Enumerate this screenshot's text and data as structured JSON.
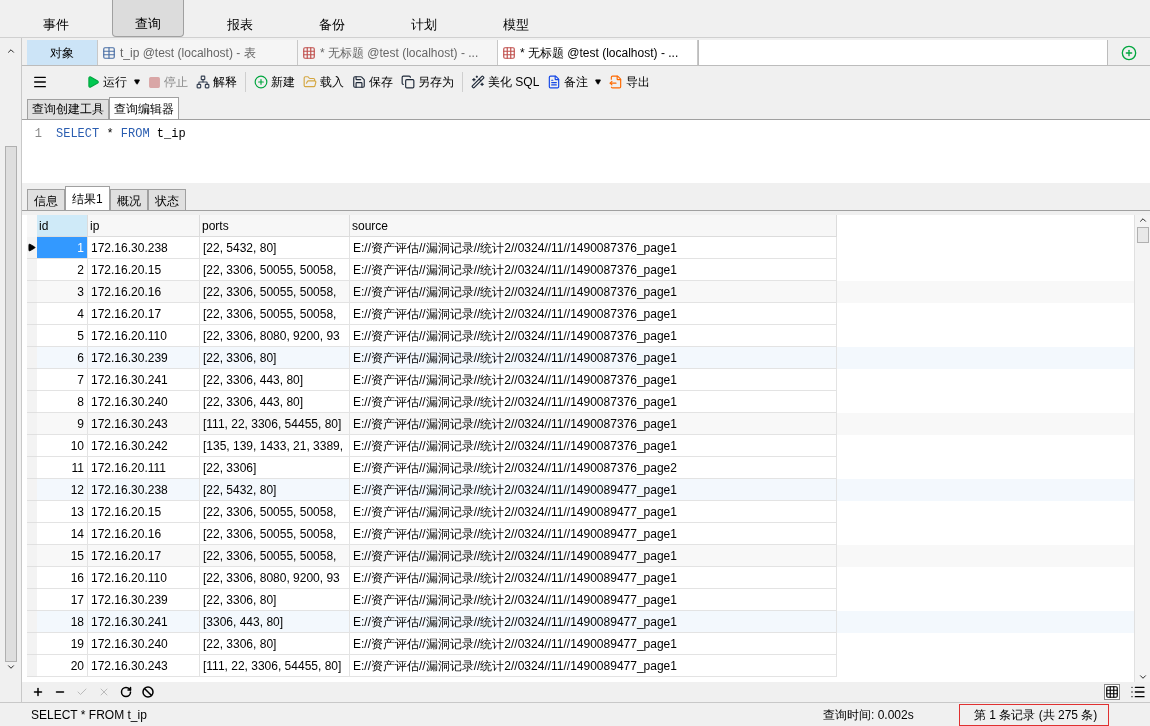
{
  "ribbon": [
    {
      "label": "事件",
      "selected": false
    },
    {
      "label": "查询",
      "selected": true
    },
    {
      "label": "报表",
      "selected": false
    },
    {
      "label": "备份",
      "selected": false
    },
    {
      "label": "计划",
      "selected": false
    },
    {
      "label": "模型",
      "selected": false
    }
  ],
  "doc_tabs": [
    {
      "label": "对象",
      "kind": "object",
      "selected": false
    },
    {
      "label": "t_ip @test (localhost) - 表",
      "kind": "table",
      "selected": false
    },
    {
      "label": "* 无标题 @test (localhost) - ...",
      "kind": "query",
      "selected": false
    },
    {
      "label": "* 无标题 @test (localhost) - ...",
      "kind": "query",
      "selected": true
    }
  ],
  "toolbar": [
    {
      "label": "运行",
      "kind": "run",
      "disabled": false,
      "dropdown": true
    },
    {
      "label": "停止",
      "kind": "stop",
      "disabled": true,
      "dropdown": false
    },
    {
      "label": "解释",
      "kind": "explain",
      "disabled": false,
      "dropdown": false
    },
    {
      "label": "新建",
      "kind": "new",
      "disabled": false,
      "dropdown": false
    },
    {
      "label": "载入",
      "kind": "load",
      "disabled": false,
      "dropdown": false
    },
    {
      "label": "保存",
      "kind": "save",
      "disabled": false,
      "dropdown": false
    },
    {
      "label": "另存为",
      "kind": "saveas",
      "disabled": false,
      "dropdown": false
    },
    {
      "label": "美化 SQL",
      "kind": "beautify",
      "disabled": false,
      "dropdown": false
    },
    {
      "label": "备注",
      "kind": "note",
      "disabled": false,
      "dropdown": true
    },
    {
      "label": "导出",
      "kind": "export",
      "disabled": false,
      "dropdown": false
    }
  ],
  "editor_tabs": [
    {
      "label": "查询创建工具",
      "selected": false
    },
    {
      "label": "查询编辑器",
      "selected": true
    }
  ],
  "editor": {
    "line_number": "1",
    "tokens": [
      {
        "text": "SELECT",
        "kind": "keyword"
      },
      {
        "text": "*",
        "kind": "plain"
      },
      {
        "text": "FROM",
        "kind": "keyword"
      },
      {
        "text": "t_ip",
        "kind": "plain"
      }
    ]
  },
  "result_tabs": [
    {
      "label": "信息",
      "selected": false
    },
    {
      "label": "结果1",
      "selected": true
    },
    {
      "label": "概况",
      "selected": false
    },
    {
      "label": "状态",
      "selected": false
    }
  ],
  "table": {
    "columns": [
      "id",
      "ip",
      "ports",
      "source"
    ],
    "rows": [
      {
        "selected": true,
        "cells": [
          "1",
          "172.16.30.238",
          "[22, 5432, 80]",
          "E://资产评估//漏洞记录//统计2//0324//11//1490087376_page1"
        ]
      },
      {
        "selected": false,
        "cells": [
          "2",
          "172.16.20.15",
          "[22, 3306, 50055, 50058,",
          "E://资产评估//漏洞记录//统计2//0324//11//1490087376_page1"
        ]
      },
      {
        "selected": false,
        "cells": [
          "3",
          "172.16.20.16",
          "[22, 3306, 50055, 50058,",
          "E://资产评估//漏洞记录//统计2//0324//11//1490087376_page1"
        ]
      },
      {
        "selected": false,
        "cells": [
          "4",
          "172.16.20.17",
          "[22, 3306, 50055, 50058,",
          "E://资产评估//漏洞记录//统计2//0324//11//1490087376_page1"
        ]
      },
      {
        "selected": false,
        "cells": [
          "5",
          "172.16.20.110",
          "[22, 3306, 8080, 9200, 93",
          "E://资产评估//漏洞记录//统计2//0324//11//1490087376_page1"
        ]
      },
      {
        "selected": false,
        "cells": [
          "6",
          "172.16.30.239",
          "[22, 3306, 80]",
          "E://资产评估//漏洞记录//统计2//0324//11//1490087376_page1"
        ]
      },
      {
        "selected": false,
        "cells": [
          "7",
          "172.16.30.241",
          "[22, 3306, 443, 80]",
          "E://资产评估//漏洞记录//统计2//0324//11//1490087376_page1"
        ]
      },
      {
        "selected": false,
        "cells": [
          "8",
          "172.16.30.240",
          "[22, 3306, 443, 80]",
          "E://资产评估//漏洞记录//统计2//0324//11//1490087376_page1"
        ]
      },
      {
        "selected": false,
        "cells": [
          "9",
          "172.16.30.243",
          "[111, 22, 3306, 54455, 80]",
          "E://资产评估//漏洞记录//统计2//0324//11//1490087376_page1"
        ]
      },
      {
        "selected": false,
        "cells": [
          "10",
          "172.16.30.242",
          "[135, 139, 1433, 21, 3389,",
          "E://资产评估//漏洞记录//统计2//0324//11//1490087376_page1"
        ]
      },
      {
        "selected": false,
        "cells": [
          "11",
          "172.16.20.111",
          "[22, 3306]",
          "E://资产评估//漏洞记录//统计2//0324//11//1490087376_page2"
        ]
      },
      {
        "selected": false,
        "cells": [
          "12",
          "172.16.30.238",
          "[22, 5432, 80]",
          "E://资产评估//漏洞记录//统计2//0324//11//1490089477_page1"
        ]
      },
      {
        "selected": false,
        "cells": [
          "13",
          "172.16.20.15",
          "[22, 3306, 50055, 50058,",
          "E://资产评估//漏洞记录//统计2//0324//11//1490089477_page1"
        ]
      },
      {
        "selected": false,
        "cells": [
          "14",
          "172.16.20.16",
          "[22, 3306, 50055, 50058,",
          "E://资产评估//漏洞记录//统计2//0324//11//1490089477_page1"
        ]
      },
      {
        "selected": false,
        "cells": [
          "15",
          "172.16.20.17",
          "[22, 3306, 50055, 50058,",
          "E://资产评估//漏洞记录//统计2//0324//11//1490089477_page1"
        ]
      },
      {
        "selected": false,
        "cells": [
          "16",
          "172.16.20.110",
          "[22, 3306, 8080, 9200, 93",
          "E://资产评估//漏洞记录//统计2//0324//11//1490089477_page1"
        ]
      },
      {
        "selected": false,
        "cells": [
          "17",
          "172.16.30.239",
          "[22, 3306, 80]",
          "E://资产评估//漏洞记录//统计2//0324//11//1490089477_page1"
        ]
      },
      {
        "selected": false,
        "cells": [
          "18",
          "172.16.30.241",
          "[3306, 443, 80]",
          "E://资产评估//漏洞记录//统计2//0324//11//1490089477_page1"
        ]
      },
      {
        "selected": false,
        "cells": [
          "19",
          "172.16.30.240",
          "[22, 3306, 80]",
          "E://资产评估//漏洞记录//统计2//0324//11//1490089477_page1"
        ]
      },
      {
        "selected": false,
        "cells": [
          "20",
          "172.16.30.243",
          "[111, 22, 3306, 54455, 80]",
          "E://资产评估//漏洞记录//统计2//0324//11//1490089477_page1"
        ]
      }
    ]
  },
  "status_bar": {
    "sql": "SELECT * FROM t_ip",
    "query_time": "查询时间: 0.002s",
    "record": "第 1 条记录 (共 275 条)"
  }
}
